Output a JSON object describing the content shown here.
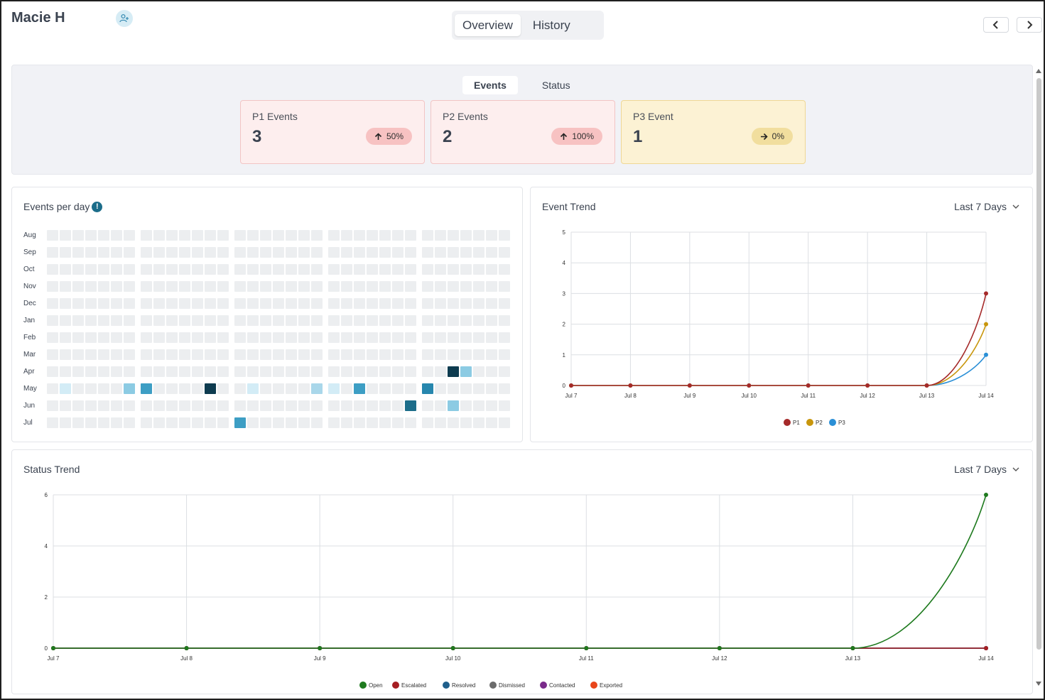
{
  "header": {
    "user_name": "Macie H",
    "tabs": [
      {
        "label": "Overview",
        "active": true
      },
      {
        "label": "History",
        "active": false
      }
    ]
  },
  "summary": {
    "tabs": [
      {
        "label": "Events",
        "active": true
      },
      {
        "label": "Status",
        "active": false
      }
    ],
    "cards": [
      {
        "label": "P1 Events",
        "value": "3",
        "change": "50%",
        "trend": "up",
        "tone": "red"
      },
      {
        "label": "P2 Events",
        "value": "2",
        "change": "100%",
        "trend": "up",
        "tone": "red"
      },
      {
        "label": "P3 Event",
        "value": "1",
        "change": "0%",
        "trend": "flat",
        "tone": "yellow"
      }
    ]
  },
  "heatmap": {
    "title": "Events per day",
    "months": [
      "Aug",
      "Sep",
      "Oct",
      "Nov",
      "Dec",
      "Jan",
      "Feb",
      "Mar",
      "Apr",
      "May",
      "Jun",
      "Jul"
    ],
    "level_colors": [
      "#eceef0",
      "#d3ecf6",
      "#a9d7ea",
      "#8ccbe3",
      "#3d9ec4",
      "#2787ae",
      "#1c6d8a",
      "#0d3b4f"
    ],
    "active_cells": [
      {
        "month": "Apr",
        "day": 30,
        "level": 7
      },
      {
        "month": "Apr",
        "day": 31,
        "level": 3
      },
      {
        "month": "May",
        "day": 1,
        "level": 1
      },
      {
        "month": "May",
        "day": 6,
        "level": 3
      },
      {
        "month": "May",
        "day": 7,
        "level": 4
      },
      {
        "month": "May",
        "day": 12,
        "level": 7
      },
      {
        "month": "May",
        "day": 15,
        "level": 1
      },
      {
        "month": "May",
        "day": 20,
        "level": 2
      },
      {
        "month": "May",
        "day": 21,
        "level": 1
      },
      {
        "month": "May",
        "day": 23,
        "level": 4
      },
      {
        "month": "May",
        "day": 28,
        "level": 5
      },
      {
        "month": "Jun",
        "day": 27,
        "level": 6
      },
      {
        "month": "Jun",
        "day": 30,
        "level": 3
      },
      {
        "month": "Jul",
        "day": 14,
        "level": 4
      }
    ]
  },
  "event_trend": {
    "title": "Event Trend",
    "range_label": "Last 7 Days"
  },
  "status_trend": {
    "title": "Status Trend",
    "range_label": "Last 7 Days"
  },
  "chart_data": [
    {
      "type": "line",
      "title": "Event Trend",
      "x": [
        "Jul 7",
        "Jul 8",
        "Jul 9",
        "Jul 10",
        "Jul 11",
        "Jul 12",
        "Jul 13",
        "Jul 14"
      ],
      "ylim": [
        0,
        5
      ],
      "yticks": [
        0,
        1,
        2,
        3,
        4,
        5
      ],
      "grid": true,
      "legend": "bottom",
      "series": [
        {
          "name": "P1",
          "color": "#a52a2a",
          "values": [
            0,
            0,
            0,
            0,
            0,
            0,
            0,
            3
          ]
        },
        {
          "name": "P2",
          "color": "#c8960c",
          "values": [
            0,
            0,
            0,
            0,
            0,
            0,
            0,
            2
          ]
        },
        {
          "name": "P3",
          "color": "#2a8fd6",
          "values": [
            0,
            0,
            0,
            0,
            0,
            0,
            0,
            1
          ]
        }
      ]
    },
    {
      "type": "line",
      "title": "Status Trend",
      "x": [
        "Jul 7",
        "Jul 8",
        "Jul 9",
        "Jul 10",
        "Jul 11",
        "Jul 12",
        "Jul 13",
        "Jul 14"
      ],
      "ylim": [
        0,
        6
      ],
      "yticks": [
        0,
        2,
        4,
        6
      ],
      "grid": true,
      "legend": "bottom",
      "series": [
        {
          "name": "Open",
          "color": "#1e7a1e",
          "values": [
            0,
            0,
            0,
            0,
            0,
            0,
            0,
            6
          ]
        },
        {
          "name": "Escalated",
          "color": "#a51e22",
          "values": [
            0,
            0,
            0,
            0,
            0,
            0,
            0,
            0
          ]
        },
        {
          "name": "Resolved",
          "color": "#1f5f8b",
          "values": [
            0,
            0,
            0,
            0,
            0,
            0,
            0,
            0
          ]
        },
        {
          "name": "Dismissed",
          "color": "#6b6b6b",
          "values": [
            0,
            0,
            0,
            0,
            0,
            0,
            0,
            0
          ]
        },
        {
          "name": "Contacted",
          "color": "#7a2a8a",
          "values": [
            0,
            0,
            0,
            0,
            0,
            0,
            0,
            0
          ]
        },
        {
          "name": "Exported",
          "color": "#e8451b",
          "values": [
            0,
            0,
            0,
            0,
            0,
            0,
            0,
            0
          ]
        }
      ]
    }
  ]
}
